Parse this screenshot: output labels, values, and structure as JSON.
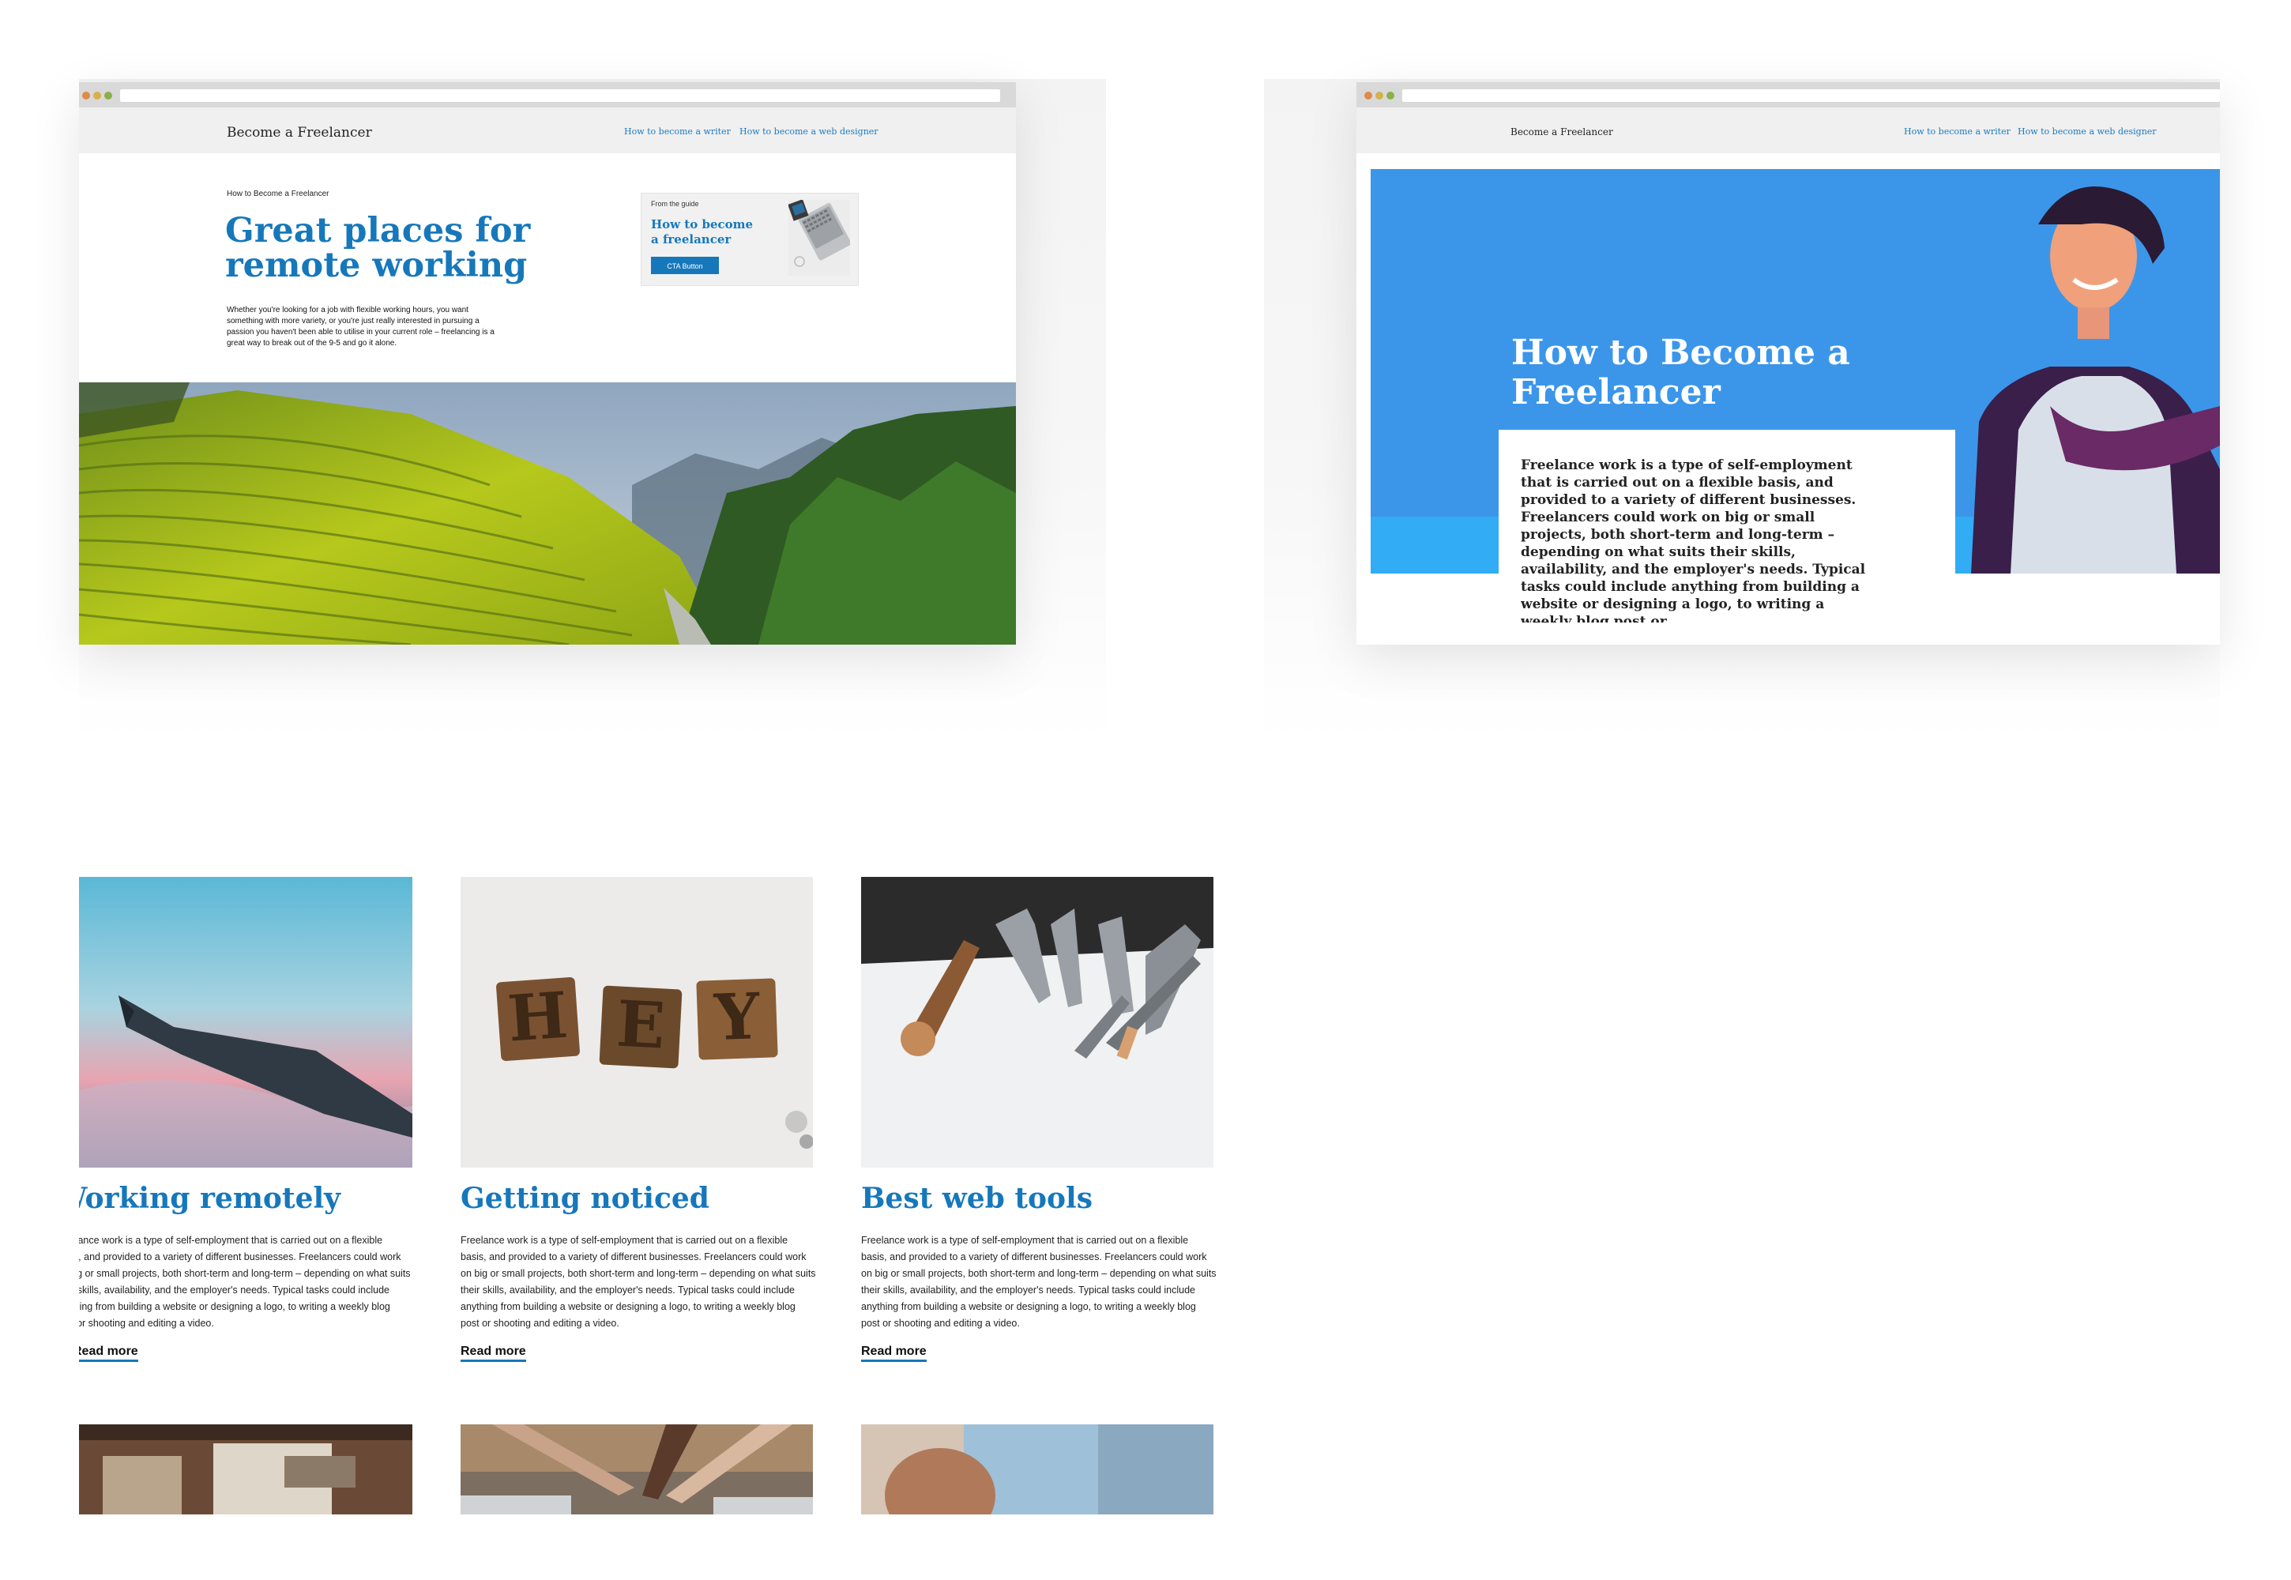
{
  "left_site": {
    "brand": "Become a Freelancer",
    "nav": [
      "How to become a writer",
      "How to become a web designer"
    ],
    "eyebrow": "How to Become a Freelancer",
    "title_line1": "Great places for",
    "title_line2": "remote working",
    "body": "Whether you're looking for a job with flexible working hours, you want something with more variety, or you're just really interested in pursuing a passion you haven't been able to utilise in your current role – freelancing is a great way to break out of the 9-5 and go it alone.",
    "guide": {
      "tag": "From the guide",
      "title": "How to become a freelancer",
      "cta": "CTA Button"
    }
  },
  "right_site": {
    "brand": "Become a Freelancer",
    "nav": [
      "How to become a writer",
      "How to become a web designer"
    ],
    "hero_title_line1": "How to Become a",
    "hero_title_line2": "Freelancer",
    "hero_body": "Freelance work is a type of self-employment that is carried out on a flexible basis, and provided to a variety of different businesses. Freelancers could work on big or small projects, both short-term and long-term – depending on what suits their skills, availability, and the employer's needs. Typical tasks could include anything from building a website or designing a logo, to writing a weekly blog post or"
  },
  "cards": [
    {
      "title": "Working remotely",
      "body": "Freelance work is a type of self-employment that is carried out on a flexible basis, and provided to a variety of different businesses. Freelancers could work on big or small projects, both short-term and long-term – depending on what suits their skills, availability, and the employer's needs. Typical tasks could include anything from building a website or designing a logo, to writing a weekly blog post or shooting and editing a video.",
      "link": "Read more"
    },
    {
      "title": "Getting noticed",
      "body": "Freelance work is a type of self-employment that is carried out on a flexible basis, and provided to a variety of different businesses. Freelancers could work on big or small projects, both short-term and long-term – depending on what suits their skills, availability, and the employer's needs. Typical tasks could include anything from building a website or designing a logo, to writing a weekly blog post or shooting and editing a video.",
      "link": "Read more"
    },
    {
      "title": "Best web tools",
      "body": "Freelance work is a type of self-employment that is carried out on a flexible basis, and provided to a variety of different businesses. Freelancers could work on big or small projects, both short-term and long-term – depending on what suits their skills, availability, and the employer's needs. Typical tasks could include anything from building a website or designing a logo, to writing a weekly blog post or shooting and editing a video.",
      "link": "Read more"
    }
  ],
  "colors": {
    "accent": "#1678bb",
    "hero_blue": "#2f93ec",
    "nav_bg": "#f0f0f0"
  }
}
